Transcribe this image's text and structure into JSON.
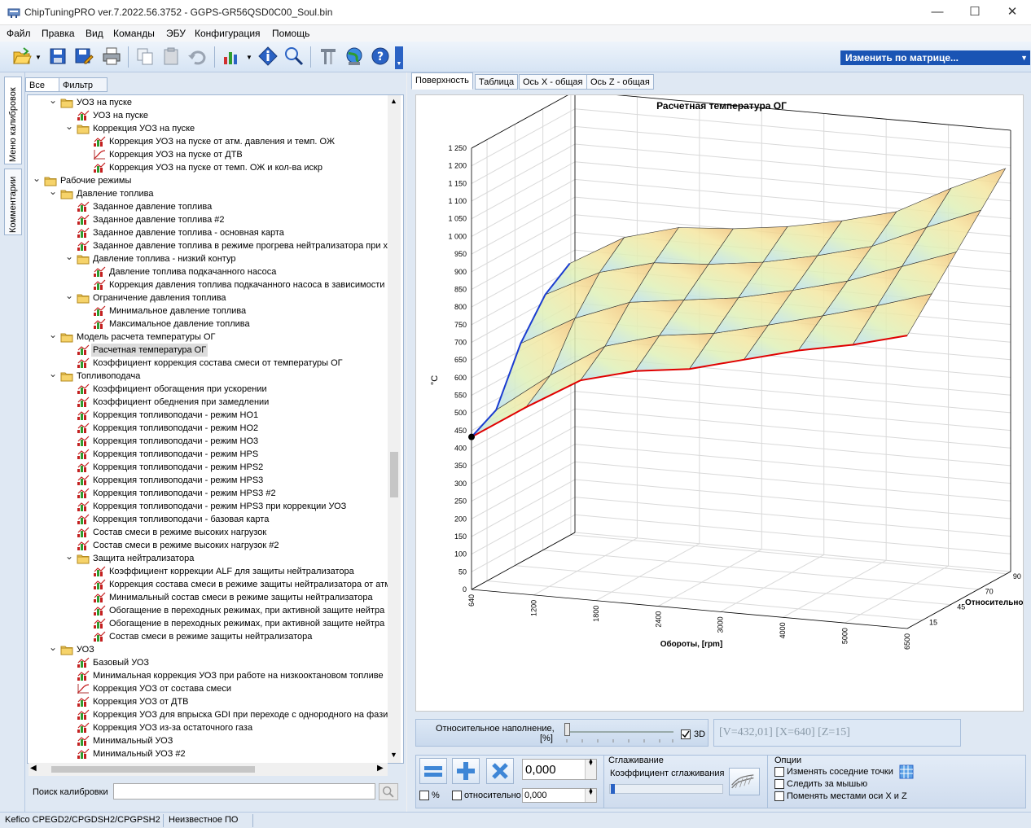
{
  "window": {
    "title": "ChipTuningPRO ver.7.2022.56.3752 - GGPS-GR56QSD0C00_Soul.bin",
    "minimize": "—",
    "maximize": "☐",
    "close": "✕"
  },
  "menu": [
    "Файл",
    "Правка",
    "Вид",
    "Команды",
    "ЭБУ",
    "Конфигурация",
    "Помощь"
  ],
  "toolbar": {
    "icons": [
      "open-folder-icon",
      "save-icon",
      "save-as-icon",
      "print-icon",
      "copy-icon",
      "paste-icon",
      "undo-icon",
      "chart-select-icon",
      "info-icon",
      "zoom-search-icon",
      "settings-tool-icon",
      "internet-globe-icon",
      "help-icon"
    ],
    "matrix_button": "Изменить по матрице..."
  },
  "side_tabs": {
    "calibration_menu": "Меню калибровок",
    "comments": "Комментарии"
  },
  "tree_tabs": {
    "all": "Все",
    "filter": "Фильтр"
  },
  "tree": [
    {
      "level": 1,
      "type": "folder",
      "exp": "open",
      "label": "УОЗ на пуске"
    },
    {
      "level": 2,
      "type": "map",
      "label": "УОЗ на пуске"
    },
    {
      "level": 2,
      "type": "folder",
      "exp": "open",
      "label": "Коррекция УОЗ на пуске"
    },
    {
      "level": 3,
      "type": "map",
      "label": "Коррекция УОЗ на пуске от атм. давления и темп. ОЖ"
    },
    {
      "level": 3,
      "type": "curve",
      "label": "Коррекция УОЗ на пуске от ДТВ"
    },
    {
      "level": 3,
      "type": "map",
      "label": "Коррекция УОЗ на пуске от темп. ОЖ и кол-ва искр"
    },
    {
      "level": 0,
      "type": "folder",
      "exp": "open",
      "label": "Рабочие режимы"
    },
    {
      "level": 1,
      "type": "folder",
      "exp": "open",
      "label": "Давление топлива"
    },
    {
      "level": 2,
      "type": "map",
      "label": "Заданное давление топлива"
    },
    {
      "level": 2,
      "type": "map",
      "label": "Заданное давление топлива #2"
    },
    {
      "level": 2,
      "type": "map",
      "label": "Заданное давление топлива - основная карта"
    },
    {
      "level": 2,
      "type": "map",
      "label": "Заданное давление топлива в режиме прогрева нейтрализатора при х"
    },
    {
      "level": 2,
      "type": "folder",
      "exp": "open",
      "label": "Давление топлива - низкий контур"
    },
    {
      "level": 3,
      "type": "map",
      "label": "Давление топлива подкачанного насоса"
    },
    {
      "level": 3,
      "type": "map",
      "label": "Коррекция давления топлива подкачанного насоса в зависимости"
    },
    {
      "level": 2,
      "type": "folder",
      "exp": "open",
      "label": "Ограничение давления топлива"
    },
    {
      "level": 3,
      "type": "map",
      "label": "Минимальное давление топлива"
    },
    {
      "level": 3,
      "type": "map",
      "label": "Максимальное давление топлива"
    },
    {
      "level": 1,
      "type": "folder",
      "exp": "open",
      "label": "Модель расчета температуры ОГ"
    },
    {
      "level": 2,
      "type": "map",
      "selected": true,
      "label": "Расчетная температура ОГ"
    },
    {
      "level": 2,
      "type": "map",
      "label": "Коэффициент коррекция состава смеси от температуры ОГ"
    },
    {
      "level": 1,
      "type": "folder",
      "exp": "open",
      "label": "Топливоподача"
    },
    {
      "level": 2,
      "type": "map",
      "label": "Коэффициент обогащения при ускорении"
    },
    {
      "level": 2,
      "type": "map",
      "label": "Коэффициент обеднения при замедлении"
    },
    {
      "level": 2,
      "type": "map",
      "label": "Коррекция топливоподачи - режим HO1"
    },
    {
      "level": 2,
      "type": "map",
      "label": "Коррекция топливоподачи - режим HO2"
    },
    {
      "level": 2,
      "type": "map",
      "label": "Коррекция топливоподачи - режим HO3"
    },
    {
      "level": 2,
      "type": "map",
      "label": "Коррекция топливоподачи - режим HPS"
    },
    {
      "level": 2,
      "type": "map",
      "label": "Коррекция топливоподачи - режим HPS2"
    },
    {
      "level": 2,
      "type": "map",
      "label": "Коррекция топливоподачи - режим HPS3"
    },
    {
      "level": 2,
      "type": "map",
      "label": "Коррекция топливоподачи - режим HPS3 #2"
    },
    {
      "level": 2,
      "type": "map",
      "label": "Коррекция топливоподачи - режим HPS3 при коррекции УОЗ"
    },
    {
      "level": 2,
      "type": "map",
      "label": "Коррекция топливоподачи - базовая карта"
    },
    {
      "level": 2,
      "type": "map",
      "label": "Состав смеси в режиме высоких нагрузок"
    },
    {
      "level": 2,
      "type": "map",
      "label": "Состав смеси в режиме высоких нагрузок #2"
    },
    {
      "level": 2,
      "type": "folder",
      "exp": "open",
      "label": "Защита нейтрализатора"
    },
    {
      "level": 3,
      "type": "map",
      "label": "Коэффициент коррекции ALF для защиты нейтрализатора"
    },
    {
      "level": 3,
      "type": "map",
      "label": "Коррекция состава смеси в режиме защиты нейтрализатора от атм"
    },
    {
      "level": 3,
      "type": "map",
      "label": "Минимальный состав смеси в режиме защиты нейтрализатора"
    },
    {
      "level": 3,
      "type": "map",
      "label": "Обогащение в переходных режимах, при активной защите нейтра"
    },
    {
      "level": 3,
      "type": "map",
      "label": "Обогащение в переходных режимах, при активной защите нейтра"
    },
    {
      "level": 3,
      "type": "map",
      "label": "Состав смеси в режиме защиты нейтрализатора"
    },
    {
      "level": 1,
      "type": "folder",
      "exp": "open",
      "label": "УОЗ"
    },
    {
      "level": 2,
      "type": "map",
      "label": "Базовый УОЗ"
    },
    {
      "level": 2,
      "type": "map",
      "label": "Минимальная коррекция УОЗ при работе на низкооктановом топливе"
    },
    {
      "level": 2,
      "type": "curve",
      "label": "Коррекция УОЗ от состава смеси"
    },
    {
      "level": 2,
      "type": "map",
      "label": "Коррекция УОЗ от ДТВ"
    },
    {
      "level": 2,
      "type": "map",
      "label": "Коррекция УОЗ для впрыска GDI при переходе с однородного на фази"
    },
    {
      "level": 2,
      "type": "map",
      "label": "Коррекция УОЗ из-за остаточного газа"
    },
    {
      "level": 2,
      "type": "map",
      "label": "Минимальный УОЗ"
    },
    {
      "level": 2,
      "type": "map",
      "label": "Минимальный УОЗ #2"
    }
  ],
  "search": {
    "label": "Поиск калибровки",
    "value": ""
  },
  "view_tabs": [
    "Поверхность",
    "Таблица",
    "Ось X - общая",
    "Ось Z - общая"
  ],
  "chart_data": {
    "type": "surface3d",
    "title": "Расчетная температура ОГ",
    "ylabel": "°C",
    "xlabel": "Обороты, [rpm]",
    "zlabel": "Относительное",
    "x_ticks": [
      "640",
      "1200",
      "1800",
      "2400",
      "3000",
      "4000",
      "5000",
      "6500"
    ],
    "z_ticks": [
      "15",
      "45",
      "70",
      "90"
    ],
    "y_ticks": [
      "0",
      "50",
      "100",
      "150",
      "200",
      "250",
      "300",
      "350",
      "400",
      "450",
      "500",
      "550",
      "600",
      "650",
      "700",
      "750",
      "800",
      "850",
      "900",
      "950",
      "1 000",
      "1 050",
      "1 100",
      "1 150",
      "1 200",
      "1 250"
    ],
    "ylim": [
      0,
      1250
    ],
    "front_edge_series": {
      "name": "front",
      "color": "#e00000",
      "values": [
        432,
        530,
        620,
        660,
        680,
        720,
        760,
        790,
        830
      ]
    },
    "left_edge_series": {
      "name": "left",
      "color": "#1a3cd0",
      "values": [
        432,
        470,
        620,
        720,
        770
      ]
    }
  },
  "controls": {
    "slider_label_1": "Относительное наполнение,",
    "slider_label_2": "[%]",
    "slider_value": 0.0,
    "check_3d": "3D",
    "readout": "[V=432,01] [X=640] [Z=15]",
    "value_input": "0,000",
    "percent_label": "%",
    "relative_label": "относительно",
    "relative_input": "0,000",
    "smoothing_title": "Сглаживание",
    "smoothing_coef": "Коэффициент сглаживания",
    "options_title": "Опции",
    "opt_neighbors": "Изменять соседние точки",
    "opt_follow_mouse": "Следить за мышью",
    "opt_swap_axes": "Поменять местами оси X и Z"
  },
  "status": {
    "ecu": "Kefico CPEGD2/CPGDSH2/CPGPSH2",
    "software": "Неизвестное ПО"
  },
  "colors": {
    "accent": "#1a54b4",
    "panel": "#dfe8f3",
    "front_edge": "#e00000",
    "left_edge": "#1a3cd0"
  }
}
